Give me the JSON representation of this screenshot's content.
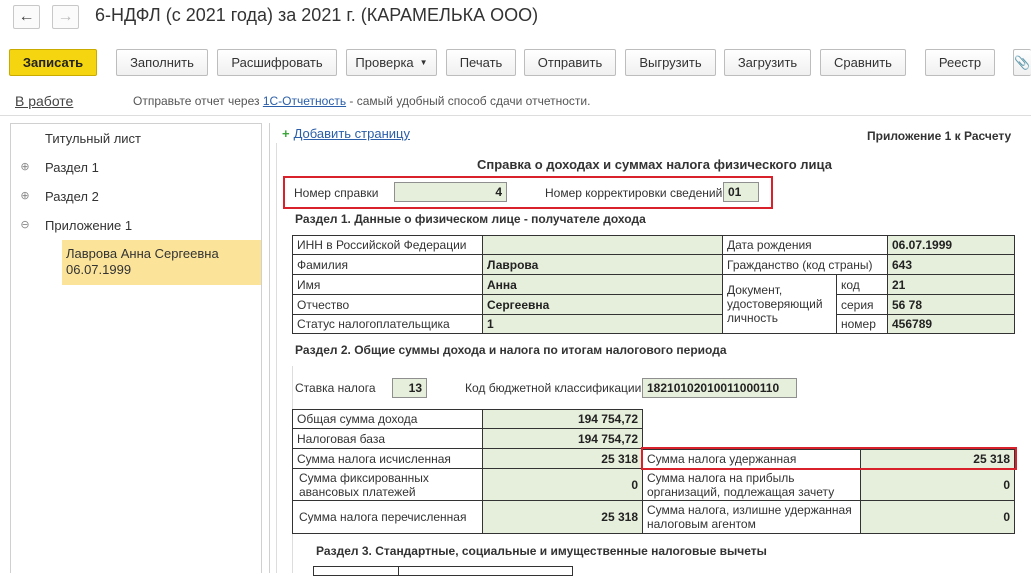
{
  "window": {
    "title": "6-НДФЛ (с 2021 года) за 2021 г. (КАРАМЕЛЬКА ООО)",
    "back_icon": "arrow-left-icon",
    "forward_icon": "arrow-right-icon"
  },
  "toolbar": {
    "save": "Записать",
    "fill": "Заполнить",
    "decode": "Расшифровать",
    "check": "Проверка",
    "print": "Печать",
    "send": "Отправить",
    "export": "Выгрузить",
    "import": "Загрузить",
    "compare": "Сравнить",
    "registry": "Реестр",
    "attach_icon": "paperclip-icon"
  },
  "status": {
    "state": "В работе",
    "msg_prefix": "Отправьте отчет через ",
    "msg_link": "1С-Отчетность",
    "msg_suffix": " - самый удобный способ сдачи отчетности."
  },
  "tree": {
    "title_page": "Титульный лист",
    "section1": "Раздел 1",
    "section2": "Раздел 2",
    "appendix1": "Приложение 1",
    "selected": "Лаврова Анна Сергеевна 06.07.1999",
    "expand_symbol": "⊕",
    "collapse_symbol": "⊖"
  },
  "form": {
    "add_page": "Добавить страницу",
    "add_symbol": "+",
    "appendix_label": "Приложение 1 к Расчету",
    "title": "Справка о доходах и суммах налога физического лица",
    "cert_number_label": "Номер справки",
    "cert_number": "4",
    "correction_label": "Номер корректировки сведений",
    "correction_number": "01",
    "section1": {
      "heading": "Раздел 1. Данные о физическом лице - получателе дохода",
      "inn_label": "ИНН в Российской Федерации",
      "inn": "",
      "surname_label": "Фамилия",
      "surname": "Лаврова",
      "name_label": "Имя",
      "name": "Анна",
      "patronymic_label": "Отчество",
      "patronymic": "Сергеевна",
      "status_label": "Статус налогоплательщика",
      "status": "1",
      "birth_label": "Дата рождения",
      "birth": "06.07.1999",
      "citizenship_label": "Гражданство (код страны)",
      "citizenship": "643",
      "document_label": "Документ, удостоверяющий личность",
      "code_label": "код",
      "code": "21",
      "series_label": "серия",
      "series": "56 78",
      "number_label": "номер",
      "number": "456789"
    },
    "section2": {
      "heading": "Раздел 2. Общие суммы дохода и налога по итогам налогового периода",
      "rate_label": "Ставка налога",
      "rate": "13",
      "kbk_label": "Код бюджетной классификации",
      "kbk": "18210102010011000110",
      "income_label": "Общая сумма дохода",
      "income": "194 754,72",
      "base_label": "Налоговая база",
      "base": "194 754,72",
      "calc_label": "Сумма налога исчисленная",
      "calc": "25 318",
      "fixed_label": "Сумма фиксированных авансовых платежей",
      "fixed": "0",
      "transferred_label": "Сумма налога перечисленная",
      "transferred": "25 318",
      "withheld_label": "Сумма налога удержанная",
      "withheld": "25 318",
      "profit_label": "Сумма налога на прибыль организаций, подлежащая зачету",
      "profit": "0",
      "excess_label": "Сумма налога, излишне удержанная налоговым агентом",
      "excess": "0"
    },
    "section3": {
      "heading": "Раздел 3. Стандартные, социальные и имущественные налоговые вычеты"
    }
  }
}
